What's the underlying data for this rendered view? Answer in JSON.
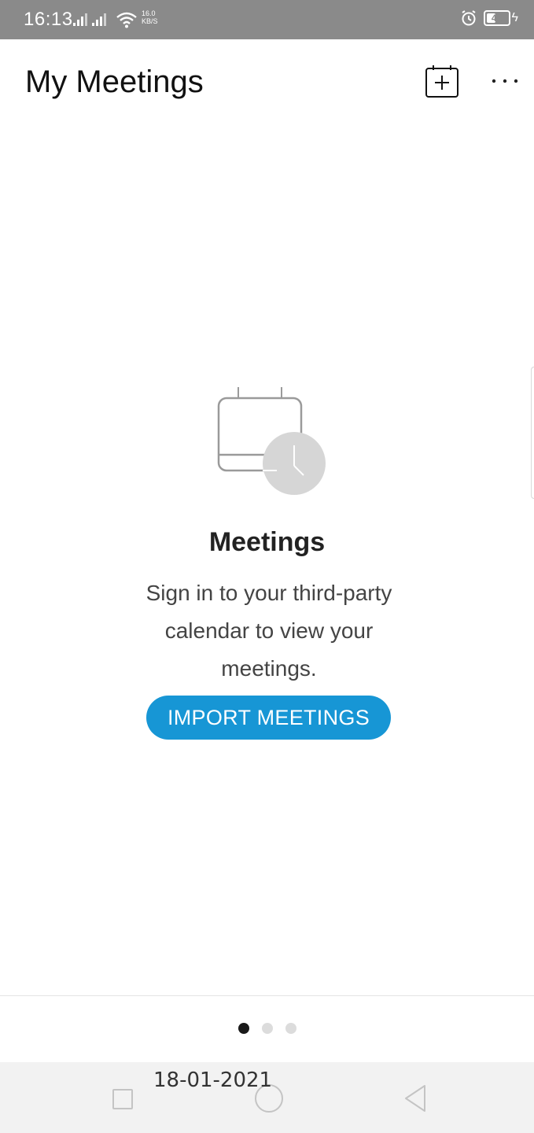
{
  "status_bar": {
    "time": "16:13",
    "net_speed_value": "16.0",
    "net_speed_unit": "KB/S",
    "battery_level": "45",
    "icons": [
      "signal-icon",
      "signal-icon",
      "wifi-icon",
      "alarm-icon",
      "battery-icon",
      "charging-icon"
    ]
  },
  "header": {
    "title": "My Meetings",
    "add_icon": "calendar-add-icon",
    "more_icon": "more-icon"
  },
  "empty_state": {
    "illustration_icon": "calendar-clock-icon",
    "title": "Meetings",
    "message": "Sign in to your third-party calendar to view your meetings.",
    "button_label": "IMPORT MEETINGS"
  },
  "pager": {
    "count": 3,
    "active_index": 0
  },
  "footer": {
    "date_stamp": "18-01-2021"
  },
  "colors": {
    "accent": "#1796d5",
    "status_bar_bg": "#8a8a8a",
    "illustration_circle": "#d6d6d6"
  }
}
